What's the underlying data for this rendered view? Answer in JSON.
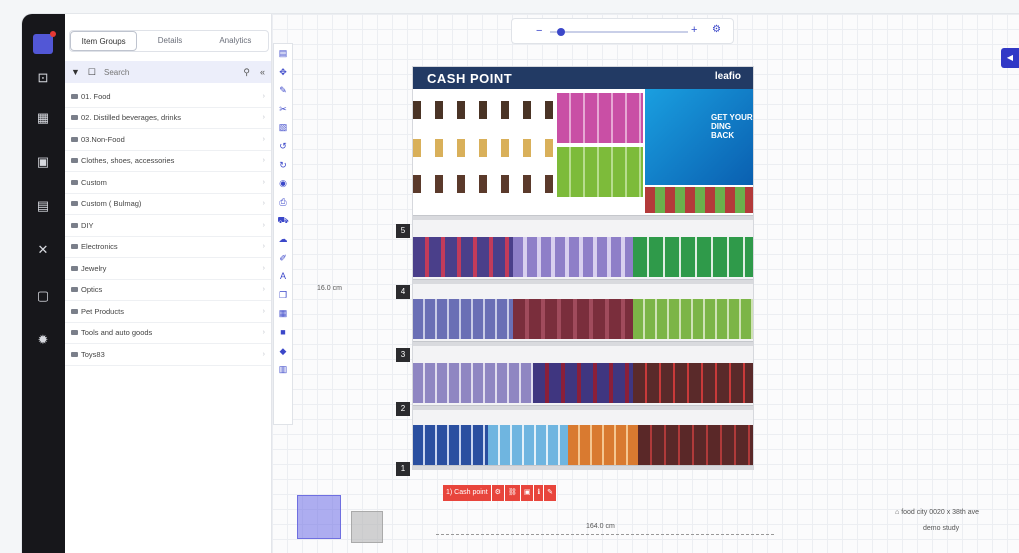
{
  "panel": {
    "tabs": [
      "Item Groups",
      "Details",
      "Analytics"
    ],
    "search": {
      "placeholder": "Search"
    },
    "groups": [
      "01. Food",
      "02. Distilled beverages, drinks",
      "03.Non-Food",
      "Clothes, shoes, accessories",
      "Custom",
      "Custom ( Bulmag)",
      "DIY",
      "Electronics",
      "Jewelry",
      "Optics",
      "Pet Products",
      "Tools and auto goods",
      "Toys83"
    ]
  },
  "planogram": {
    "title": "CASH POINT",
    "brand": "leafio",
    "ad_text": "GET YOUR DING BACK",
    "shelf_numbers": [
      "5",
      "4",
      "3",
      "2",
      "1"
    ],
    "width_label": "164.0 cm",
    "height_label": "16.0 cm",
    "ruler_marks": [
      "2",
      "3"
    ]
  },
  "shelf_actions": [
    "1) Cash point",
    "⚙",
    "⛓",
    "▣",
    "ℹ",
    "✎"
  ],
  "breadcrumb": {
    "store": "food city 0020 x 38th ave",
    "study": "demo study"
  },
  "colors": {
    "accent": "#3b47c9",
    "header": "#223a64",
    "danger": "#e8453c"
  }
}
